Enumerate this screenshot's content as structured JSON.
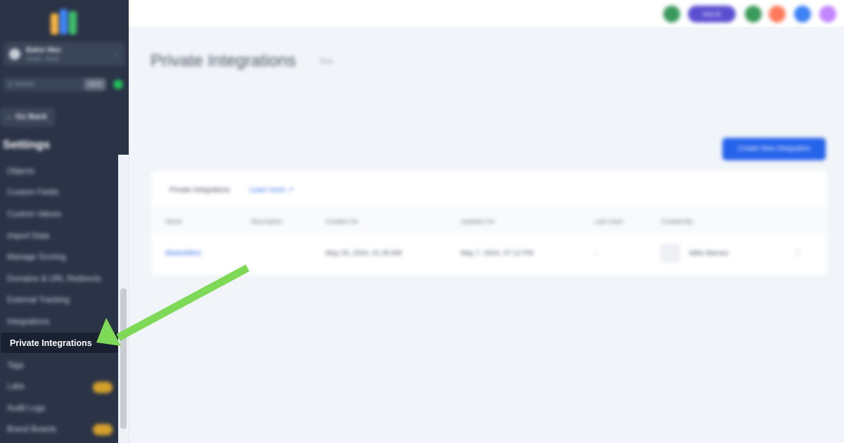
{
  "sidebar": {
    "account": {
      "name": "Baker Mav",
      "subtitle": "Austin, Texas"
    },
    "search": {
      "label": "Q Search",
      "shortcut": "ctrl K"
    },
    "go_back": "← Go Back",
    "section_title": "Settings",
    "items": [
      {
        "label": "Objects"
      },
      {
        "label": "Custom Fields"
      },
      {
        "label": "Custom Values"
      },
      {
        "label": "Import Data"
      },
      {
        "label": "Manage Scoring"
      },
      {
        "label": "Domains & URL Redirects"
      },
      {
        "label": "External Tracking"
      },
      {
        "label": "Integrations"
      },
      {
        "label": "Private Integrations",
        "active": true
      },
      {
        "label": "Tags"
      },
      {
        "label": "Labs",
        "badge": true
      },
      {
        "label": "Audit Logs"
      },
      {
        "label": "Brand Boards",
        "badge": true
      }
    ]
  },
  "header": {
    "ask_ai_label": "Ask AI",
    "icon_colors": [
      "#3a9a5b",
      "#3a9a5b",
      "#ff7a5c",
      "#3b82f6",
      "#c084fc"
    ]
  },
  "main": {
    "title": "Private Integrations",
    "title_sub": "Beta",
    "create_button": "Create New Integration",
    "card": {
      "title": "Private Integrations",
      "learn_more": "Learn more ↗",
      "columns": [
        "Name",
        "Description",
        "Created On",
        "Updated On",
        "Last Used",
        "Created By"
      ],
      "rows": [
        {
          "name": "MarketWire",
          "description": "",
          "created_on": "May 29, 2024, 01:30 AM",
          "updated_on": "May 7, 2024, 07:12 PM",
          "last_used": "-",
          "created_by": "Mike Barnes"
        }
      ]
    }
  },
  "annotation": {
    "arrow_color": "#7ed957"
  }
}
